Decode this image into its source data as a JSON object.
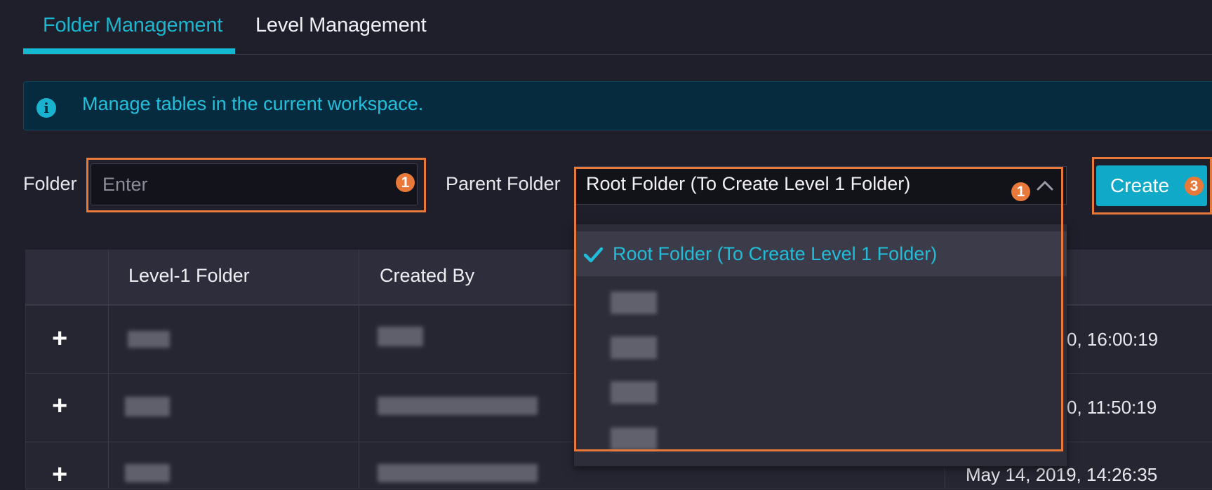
{
  "tabs": [
    {
      "label": "Folder Management",
      "active": true
    },
    {
      "label": "Level Management",
      "active": false
    }
  ],
  "banner": {
    "text": "Manage tables in the current workspace.",
    "icon": "info-icon"
  },
  "form": {
    "folder_label": "Folder",
    "folder_placeholder": "Enter",
    "parent_label": "Parent Folder",
    "parent_value": "Root Folder (To Create Level 1 Folder)",
    "create_label": "Create"
  },
  "annotations": {
    "badge_1": "1",
    "badge_2": "1",
    "badge_3": "3"
  },
  "dropdown": {
    "options": [
      {
        "label": "Root Folder (To Create Level 1 Folder)",
        "selected": true
      },
      {
        "label": "",
        "selected": false
      },
      {
        "label": "",
        "selected": false
      },
      {
        "label": "",
        "selected": false
      },
      {
        "label": "",
        "selected": false
      }
    ]
  },
  "table": {
    "headers": [
      "Level-1 Folder",
      "Created By"
    ],
    "rows": [
      {
        "folder": "",
        "created_by": "",
        "date": "0, 16:00:19"
      },
      {
        "folder": "",
        "created_by": "",
        "date": "0, 11:50:19"
      },
      {
        "folder": "",
        "created_by": "",
        "date": "May 14, 2019, 14:26:35"
      }
    ],
    "expand_symbol": "+"
  },
  "colors": {
    "accent": "#14b8d0",
    "annotation": "#e8793a",
    "background": "#1f1f2b"
  }
}
